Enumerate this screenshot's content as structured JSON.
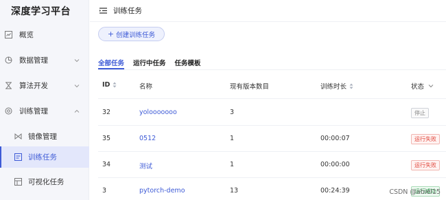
{
  "sidebar": {
    "brand": "深度学习平台",
    "items": [
      {
        "label": "概览",
        "icon": "overview-icon"
      },
      {
        "label": "数据管理",
        "icon": "data-icon"
      },
      {
        "label": "算法开发",
        "icon": "algorithm-icon"
      },
      {
        "label": "训练管理",
        "icon": "training-icon"
      }
    ],
    "sub_items": [
      {
        "label": "镜像管理",
        "icon": "image-icon"
      },
      {
        "label": "训练任务",
        "icon": "task-icon"
      },
      {
        "label": "可视化任务",
        "icon": "visualize-icon"
      }
    ]
  },
  "header": {
    "title": "训练任务"
  },
  "create_button": {
    "label": "创建训练任务"
  },
  "tabs": [
    "全部任务",
    "运行中任务",
    "任务模板"
  ],
  "table": {
    "columns": [
      "ID",
      "名称",
      "现有版本数目",
      "训练时长",
      "状态"
    ],
    "rows": [
      {
        "id": "32",
        "name": "yolooooooo",
        "versions": "3",
        "duration": "",
        "status": "停止",
        "status_type": "stopped"
      },
      {
        "id": "35",
        "name": "0512",
        "versions": "1",
        "duration": "00:00:07",
        "status": "运行失败",
        "status_type": "failed"
      },
      {
        "id": "34",
        "name": "测试",
        "versions": "1",
        "duration": "00:00:00",
        "status": "运行失败",
        "status_type": "failed"
      },
      {
        "id": "3",
        "name": "pytorch-demo",
        "versions": "13",
        "duration": "00:24:39",
        "status": "运行成功",
        "status_type": "success"
      }
    ]
  },
  "watermark": "CSDN @abiel15",
  "colors": {
    "accent": "#3d5ad6",
    "failed": "#e0453a",
    "success": "#2a9a4a"
  }
}
